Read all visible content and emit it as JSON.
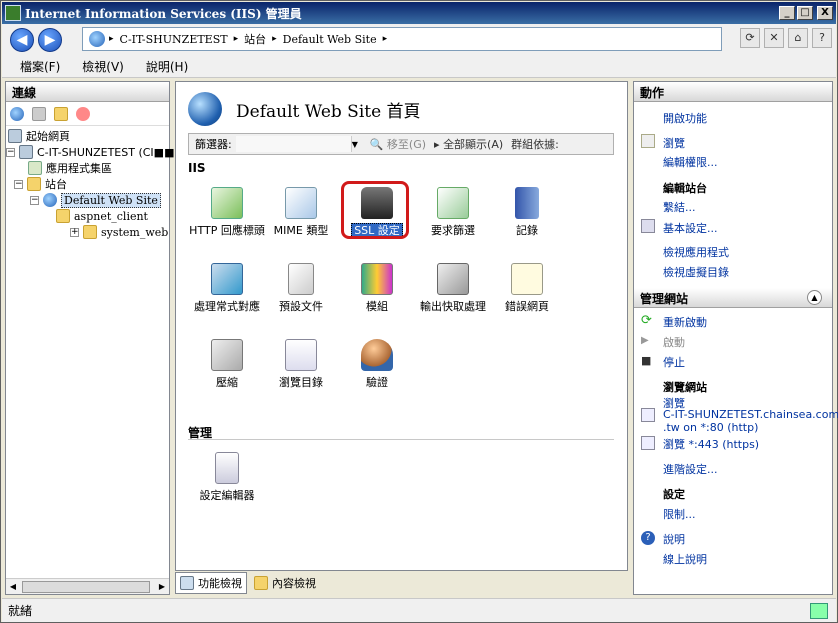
{
  "window": {
    "title": "Internet Information Services (IIS) 管理員",
    "controls": {
      "minimize": "_",
      "maximize": "□",
      "close": "X"
    }
  },
  "address": {
    "crumbs": [
      "C-IT-SHUNZETEST",
      "站台",
      "Default Web Site"
    ],
    "sep": "▸"
  },
  "menu": [
    "檔案(F)",
    "檢視(V)",
    "說明(H)"
  ],
  "connections": {
    "header": "連線",
    "tree": [
      {
        "label": "起始網頁",
        "icon": "computer-icon"
      },
      {
        "label": "C-IT-SHUNZETEST (CI■■M",
        "icon": "computer-icon"
      },
      {
        "label": "應用程式集區",
        "icon": "app-pool-icon"
      },
      {
        "label": "站台",
        "icon": "folder-icon"
      },
      {
        "label": "Default Web Site",
        "icon": "globe-icon"
      },
      {
        "label": "aspnet_client",
        "icon": "folder-icon"
      },
      {
        "label": "system_web",
        "icon": "folder-icon"
      }
    ]
  },
  "center": {
    "title": "Default Web Site 首頁",
    "filter": {
      "label": "篩選器:",
      "go": "移至(G)",
      "show_all": "全部顯示(A)",
      "group_by": "群組依據:"
    },
    "section_iis": "IIS",
    "section_mgmt": "管理",
    "features_iis": [
      {
        "label": "HTTP 回應標頭",
        "icon": "http-headers-icon"
      },
      {
        "label": "MIME 類型",
        "icon": "mime-types-icon"
      },
      {
        "label": "SSL 設定",
        "icon": "lock-icon"
      },
      {
        "label": "要求篩選",
        "icon": "request-filter-icon"
      },
      {
        "label": "記錄",
        "icon": "logging-icon"
      },
      {
        "label": "處理常式對應",
        "icon": "handler-mappings-icon"
      },
      {
        "label": "預設文件",
        "icon": "default-document-icon"
      },
      {
        "label": "模組",
        "icon": "modules-icon"
      },
      {
        "label": "輸出快取處理",
        "icon": "output-cache-icon"
      },
      {
        "label": "錯誤網頁",
        "icon": "error-pages-icon"
      },
      {
        "label": "壓縮",
        "icon": "compression-icon"
      },
      {
        "label": "瀏覽目錄",
        "icon": "directory-browsing-icon"
      },
      {
        "label": "驗證",
        "icon": "authentication-icon"
      }
    ],
    "features_mgmt": [
      {
        "label": "設定編輯器",
        "icon": "config-editor-icon"
      }
    ]
  },
  "tabs": {
    "features": "功能檢視",
    "content": "內容檢視"
  },
  "actions": {
    "header": "動作",
    "open_feature": "開啟功能",
    "browse": "瀏覽",
    "edit_permissions": "編輯權限...",
    "edit_site": "編輯站台",
    "bindings": "繫結...",
    "basic_settings": "基本設定...",
    "view_apps": "檢視應用程式",
    "view_vdirs": "檢視虛擬目錄",
    "manage_site": "管理網站",
    "restart": "重新啟動",
    "start": "啟動",
    "stop": "停止",
    "browse_site": "瀏覽網站",
    "browse_http_1": "瀏覽",
    "browse_http_2": "C-IT-SHUNZETEST.chainsea.com",
    "browse_http_3": ".tw on *:80 (http)",
    "browse_https": "瀏覽 *:443 (https)",
    "advanced": "進階設定...",
    "settings_group": "設定",
    "limits": "限制...",
    "help": "說明",
    "online_help": "線上說明"
  },
  "status": {
    "text": "就緒"
  },
  "colors": {
    "highlight_border": "#d11a1a",
    "link": "#0033a0",
    "selection": "#316ac5"
  }
}
